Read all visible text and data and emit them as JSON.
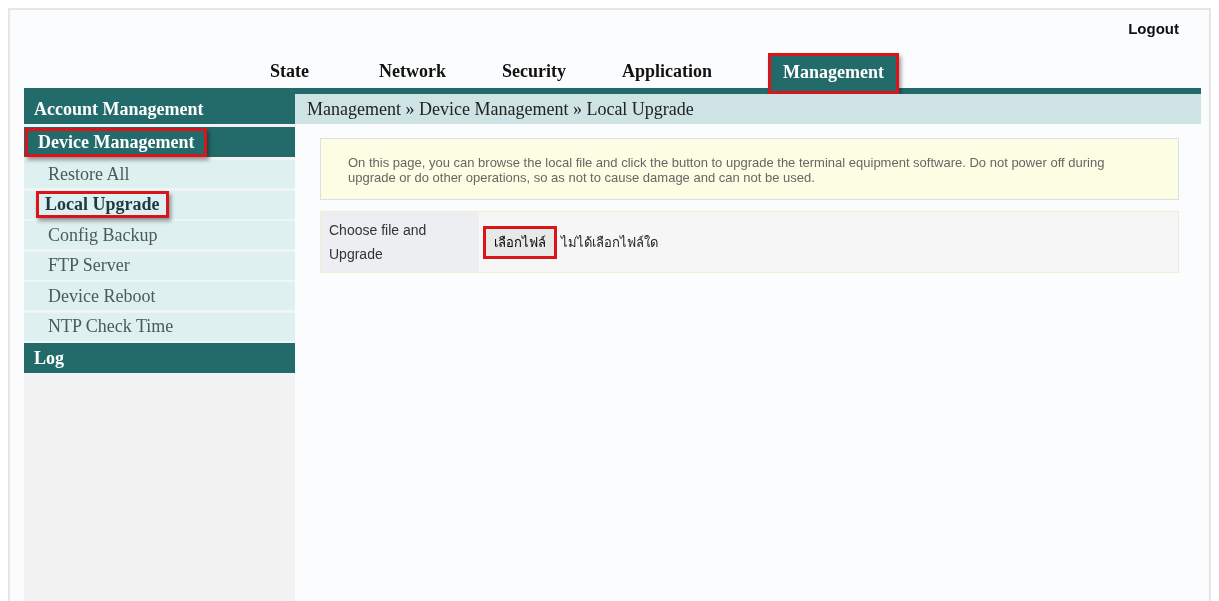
{
  "logout": "Logout",
  "tabs": [
    {
      "label": "State",
      "selected": false,
      "highlighted": false
    },
    {
      "label": "Network",
      "selected": false,
      "highlighted": false
    },
    {
      "label": "Security",
      "selected": false,
      "highlighted": false
    },
    {
      "label": "Application",
      "selected": false,
      "highlighted": false
    },
    {
      "label": "Management",
      "selected": true,
      "highlighted": true
    }
  ],
  "sidebar": {
    "groups": [
      {
        "label": "Account Management",
        "highlighted": false
      },
      {
        "label": "Device Management",
        "highlighted": true,
        "items": [
          {
            "label": "Restore All",
            "selected": false,
            "highlighted": false
          },
          {
            "label": "Local Upgrade",
            "selected": true,
            "highlighted": true
          },
          {
            "label": "Config Backup",
            "selected": false,
            "highlighted": false
          },
          {
            "label": "FTP Server",
            "selected": false,
            "highlighted": false
          },
          {
            "label": "Device Reboot",
            "selected": false,
            "highlighted": false
          },
          {
            "label": "NTP Check Time",
            "selected": false,
            "highlighted": false
          }
        ]
      },
      {
        "label": "Log",
        "highlighted": false
      }
    ]
  },
  "breadcrumb": "Management » Device Management » Local Upgrade",
  "notice": "On this page, you can browse the local file and click the button to upgrade the terminal equipment software. Do not power off during upgrade or do other operations, so as not to cause damage and can not be used.",
  "form": {
    "rows": [
      {
        "label": "Choose file and Upgrade",
        "button": {
          "label": "เลือกไฟล์",
          "highlighted": true
        },
        "status": "ไม่ได้เลือกไฟล์ใด"
      }
    ]
  }
}
